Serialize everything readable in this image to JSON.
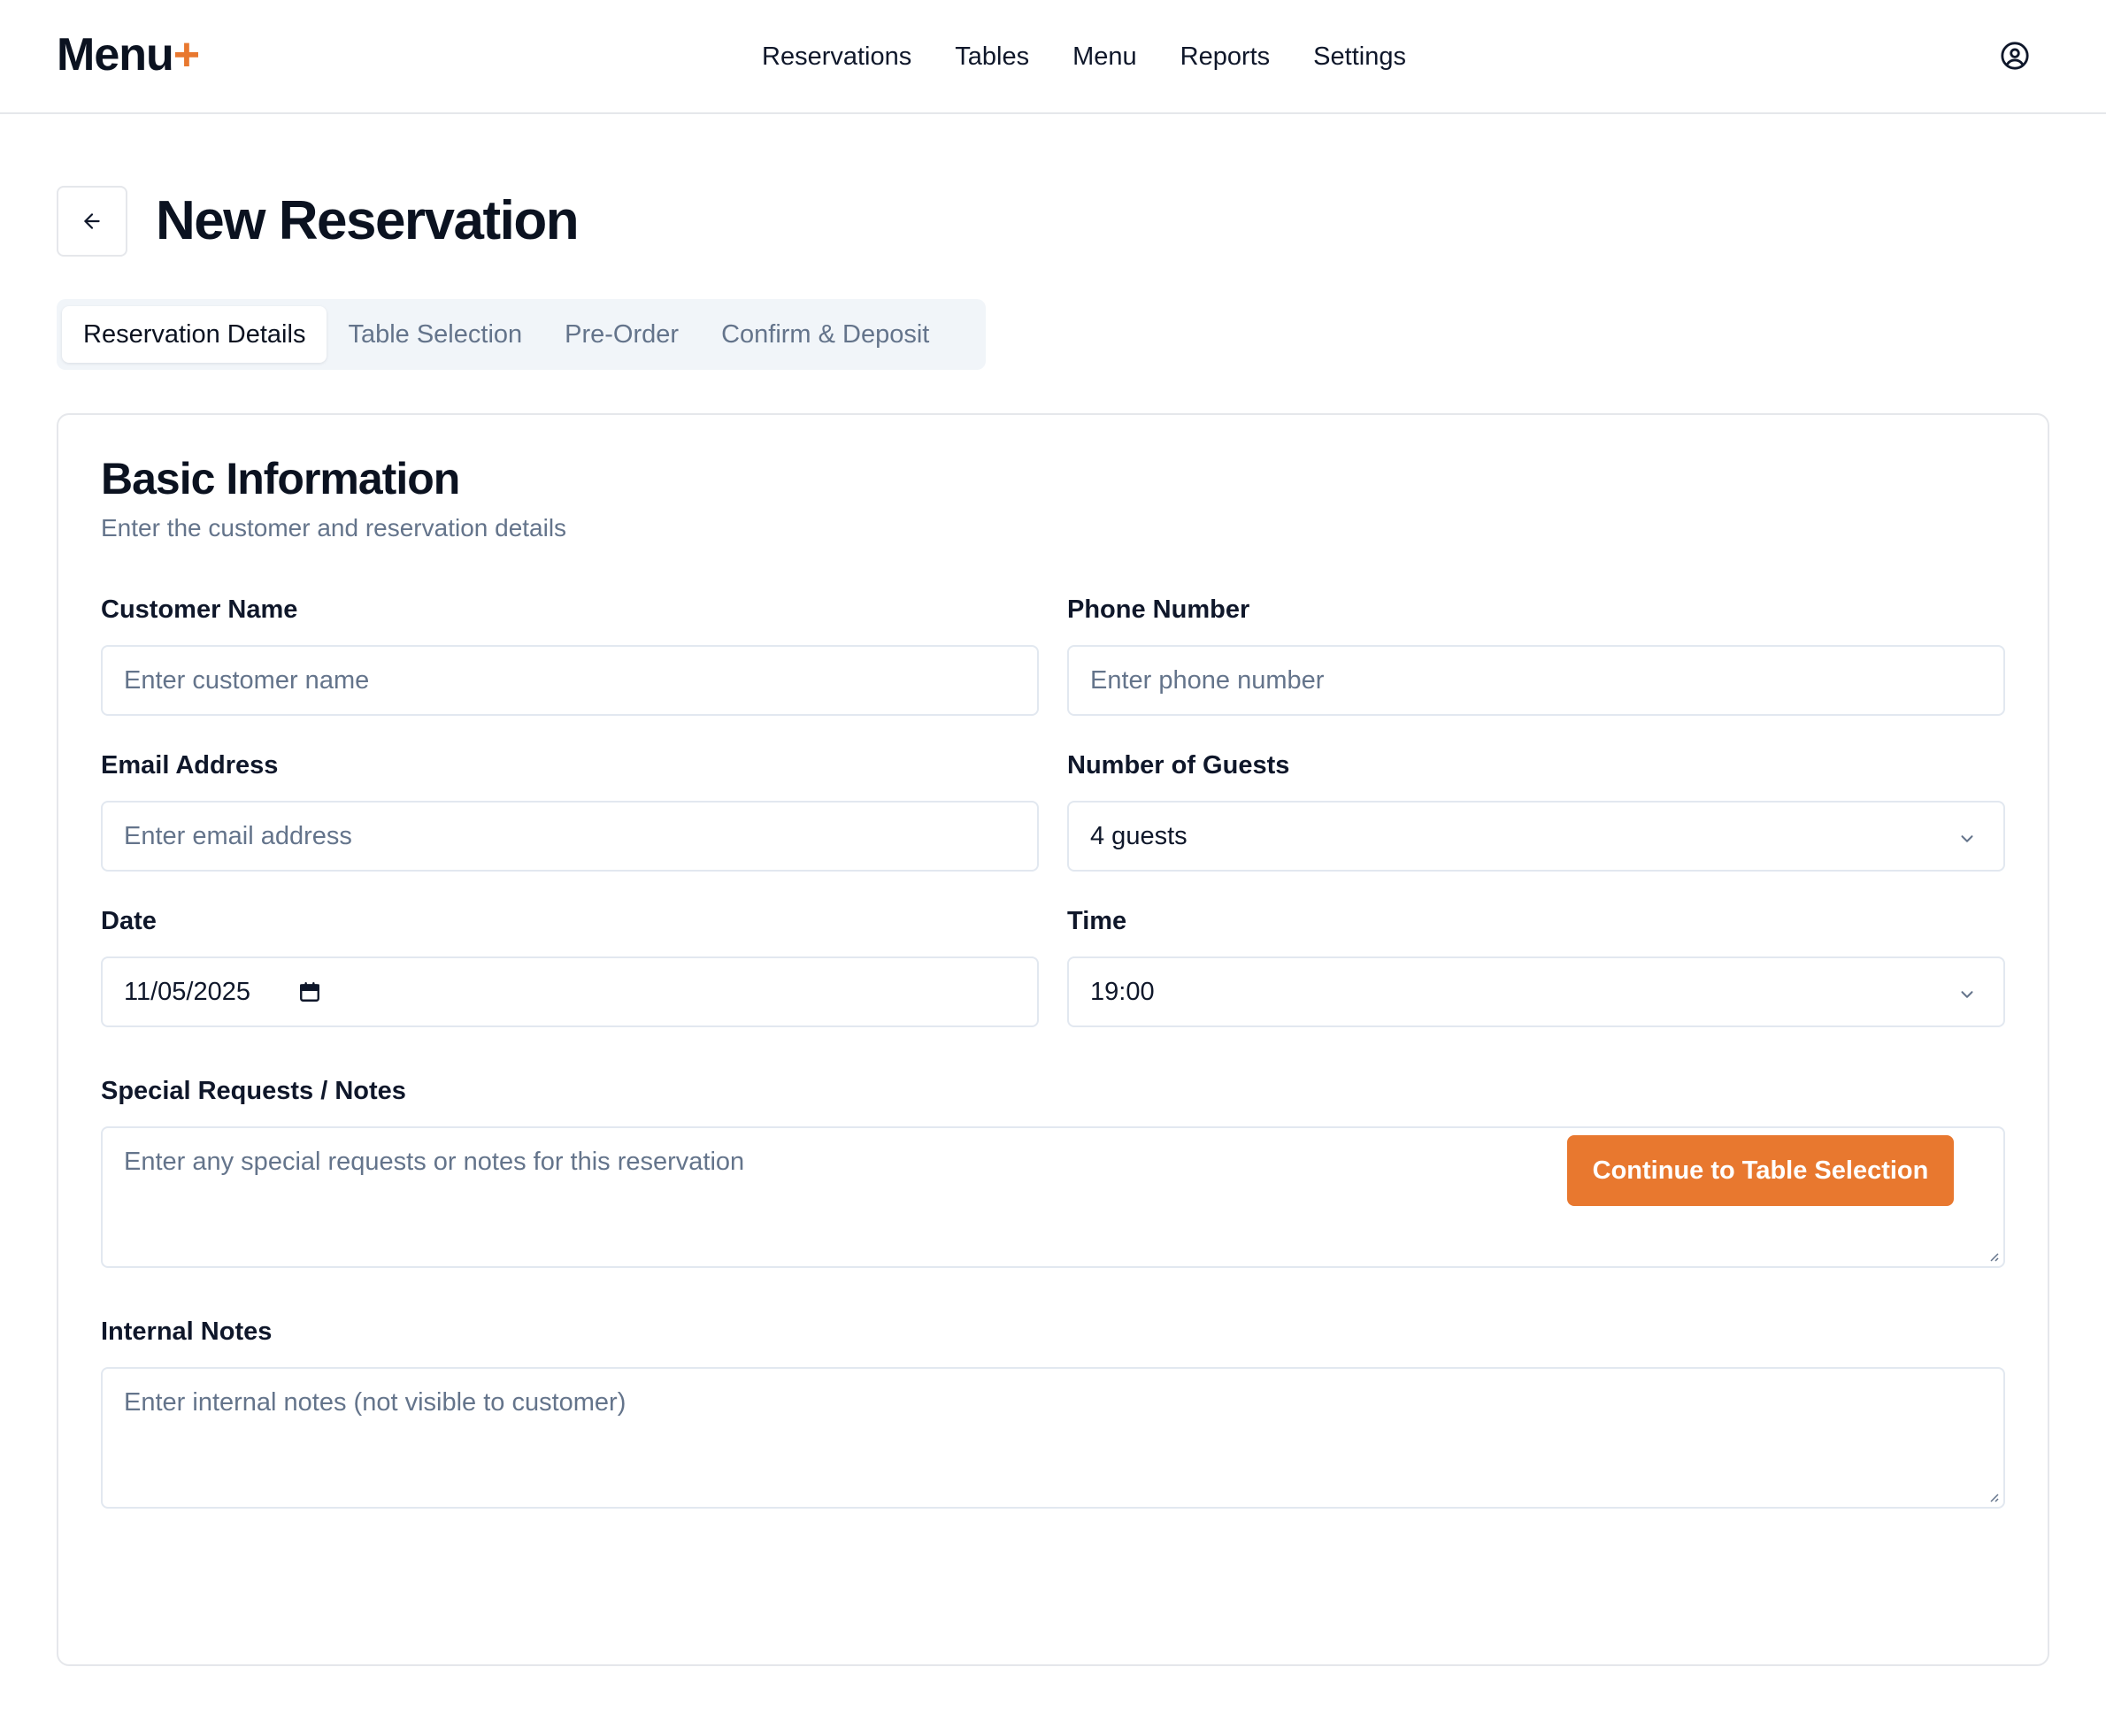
{
  "brand": {
    "name": "Menu",
    "suffix": "+",
    "accent": "#e8782f"
  },
  "nav": {
    "items": [
      "Reservations",
      "Tables",
      "Menu",
      "Reports",
      "Settings"
    ]
  },
  "header_icons": {
    "user": "user-circle-icon"
  },
  "page": {
    "title": "New Reservation",
    "back_icon": "arrow-left-icon"
  },
  "tabs": [
    {
      "label": "Reservation Details",
      "active": true
    },
    {
      "label": "Table Selection",
      "active": false
    },
    {
      "label": "Pre-Order",
      "active": false
    },
    {
      "label": "Confirm & Deposit",
      "active": false
    }
  ],
  "form": {
    "title": "Basic Information",
    "subtitle": "Enter the customer and reservation details",
    "customer_name": {
      "label": "Customer Name",
      "placeholder": "Enter customer name",
      "value": ""
    },
    "phone": {
      "label": "Phone Number",
      "placeholder": "Enter phone number",
      "value": ""
    },
    "email": {
      "label": "Email Address",
      "placeholder": "Enter email address",
      "value": ""
    },
    "guests": {
      "label": "Number of Guests",
      "value": "4 guests"
    },
    "date": {
      "label": "Date",
      "value": "11/05/2025"
    },
    "time": {
      "label": "Time",
      "value": "19:00"
    },
    "special": {
      "label": "Special Requests / Notes",
      "placeholder": "Enter any special requests or notes for this reservation"
    },
    "internal": {
      "label": "Internal Notes",
      "placeholder": "Enter internal notes (not visible to customer)"
    },
    "submit_label": "Continue to Table Selection"
  }
}
